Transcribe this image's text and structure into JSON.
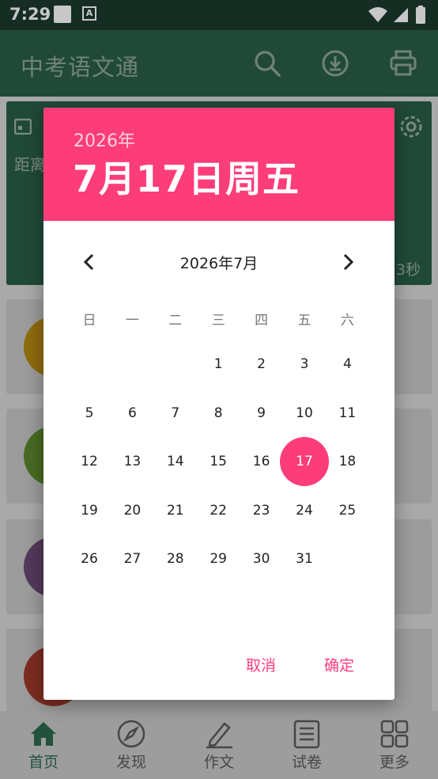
{
  "status_bar": {
    "time": "7:29",
    "notif_icon_label": "A"
  },
  "app_bar": {
    "title": "中考语文通"
  },
  "background": {
    "countdown_prefix": "距离",
    "countdown_suffix": "3秒"
  },
  "bottom_nav": {
    "items": [
      {
        "label": "首页",
        "active": true
      },
      {
        "label": "发现"
      },
      {
        "label": "作文"
      },
      {
        "label": "试卷"
      },
      {
        "label": "更多"
      }
    ]
  },
  "date_picker": {
    "header_year": "2026年",
    "header_date": "7月17日周五",
    "month_title": "2026年7月",
    "weekdays": [
      "日",
      "一",
      "二",
      "三",
      "四",
      "五",
      "六"
    ],
    "first_weekday_index": 3,
    "days_in_month": 31,
    "selected_day": "17",
    "cancel_label": "取消",
    "ok_label": "确定"
  },
  "colors": {
    "accent": "#fc3d7a",
    "app_bar": "#2b5e4a",
    "status_bar": "#1b3a2e"
  }
}
